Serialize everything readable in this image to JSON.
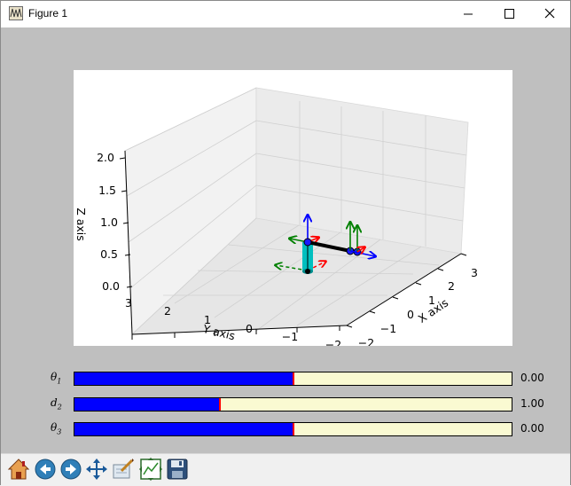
{
  "window": {
    "title": "Figure 1"
  },
  "axes": {
    "z_label": "Z axis",
    "y_label": "Y axis",
    "x_label": "X axis",
    "z_ticks": [
      "2.0",
      "1.5",
      "1.0",
      "0.5",
      "0.0"
    ],
    "y_ticks": [
      "3",
      "2",
      "1",
      "0",
      "−1",
      "−2"
    ],
    "x_ticks": [
      "3",
      "2",
      "1",
      "0",
      "−1",
      "−2"
    ]
  },
  "sliders": [
    {
      "symbol": "θ",
      "sub": "1",
      "value_text": "0.00",
      "fraction": 0.5
    },
    {
      "symbol": "d",
      "sub": "2",
      "value_text": "1.00",
      "fraction": 0.333
    },
    {
      "symbol": "θ",
      "sub": "3",
      "value_text": "0.00",
      "fraction": 0.5
    }
  ],
  "toolbar": {
    "icons": [
      "home-icon",
      "back-icon",
      "forward-icon",
      "pan-icon",
      "zoom-icon",
      "configure-subplots-icon",
      "save-icon"
    ]
  },
  "colors": {
    "slider_fill": "#0000ff",
    "slider_track": "#fafad2",
    "slider_marker": "#ff0000",
    "link": "#00bfbf"
  }
}
